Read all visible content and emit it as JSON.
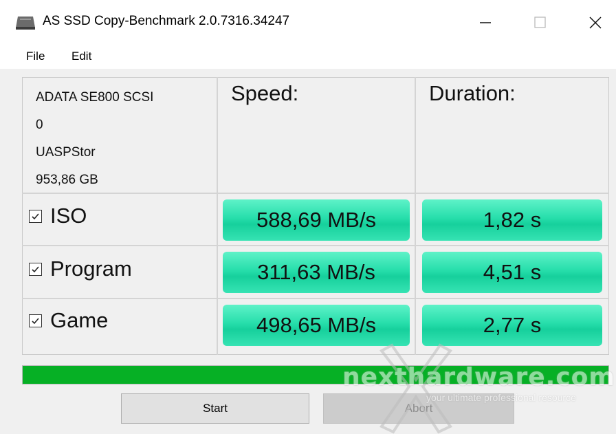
{
  "window": {
    "title": "AS SSD Copy-Benchmark 2.0.7316.34247",
    "icon": "disk-drive-icon"
  },
  "menu": {
    "file": "File",
    "edit": "Edit"
  },
  "drive": {
    "line1": "ADATA SE800 SCSI",
    "line2": "0",
    "line3": "UASPStor",
    "line4": "953,86 GB"
  },
  "headers": {
    "speed": "Speed:",
    "duration": "Duration:"
  },
  "rows": [
    {
      "label": "ISO",
      "checked": true,
      "speed": "588,69 MB/s",
      "duration": "1,82 s"
    },
    {
      "label": "Program",
      "checked": true,
      "speed": "311,63 MB/s",
      "duration": "4,51 s"
    },
    {
      "label": "Game",
      "checked": true,
      "speed": "498,65 MB/s",
      "duration": "2,77 s"
    }
  ],
  "progress": {
    "value": 1.0,
    "color": "#06b025"
  },
  "buttons": {
    "start": "Start",
    "abort": "Abort"
  },
  "watermark": {
    "name": "nexthardware.com",
    "tagline": "your ultimate professional resource"
  },
  "colors": {
    "result_fill": "#27deab",
    "progress": "#06b025"
  }
}
